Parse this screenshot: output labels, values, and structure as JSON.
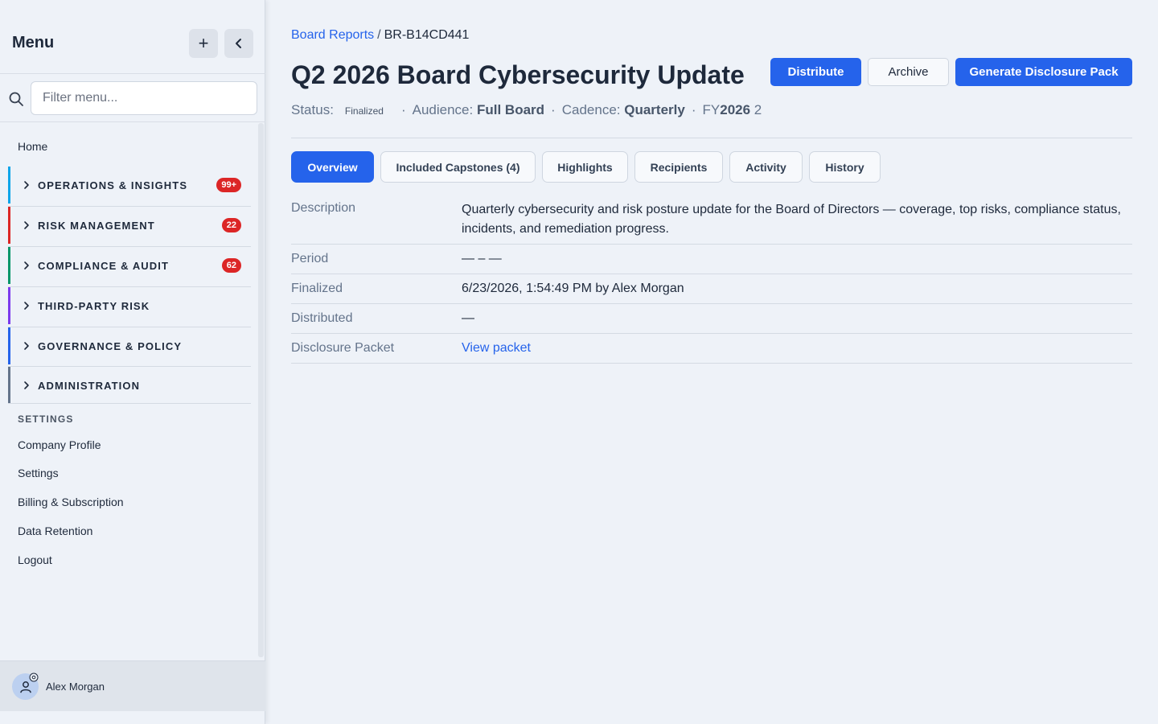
{
  "sidebar": {
    "title": "Menu",
    "add_symbol": "+",
    "filter_placeholder": "Filter menu...",
    "home": "Home",
    "groups": [
      {
        "label": "OPERATIONS & INSIGHTS",
        "badge": "99+",
        "color": "#0ea5e9"
      },
      {
        "label": "RISK MANAGEMENT",
        "badge": "22",
        "color": "#dc2626"
      },
      {
        "label": "COMPLIANCE & AUDIT",
        "badge": "62",
        "color": "#059669"
      },
      {
        "label": "THIRD-PARTY RISK",
        "badge": "",
        "color": "#7c3aed"
      },
      {
        "label": "GOVERNANCE & POLICY",
        "badge": "",
        "color": "#2563eb"
      },
      {
        "label": "ADMINISTRATION",
        "badge": "",
        "color": "#64748b"
      }
    ],
    "settings_label": "SETTINGS",
    "settings_items": [
      "Company Profile",
      "Settings",
      "Billing & Subscription",
      "Data Retention",
      "Logout"
    ],
    "user_name": "Alex Morgan"
  },
  "breadcrumb": {
    "parent": "Board Reports",
    "separator": "/",
    "current": "BR-B14CD441"
  },
  "header": {
    "title": "Q2 2026 Board Cybersecurity Update",
    "buttons": {
      "distribute": "Distribute",
      "archive": "Archive",
      "generate": "Generate Disclosure Pack"
    }
  },
  "meta": {
    "status_label": "Status:",
    "status_value": "Finalized",
    "audience_label": "Audience:",
    "audience_value": "Full Board",
    "cadence_label": "Cadence:",
    "cadence_value": "Quarterly",
    "fy_prefix": "FY",
    "fy_year": "2026",
    "fy_quarter": "2",
    "dot": "·"
  },
  "tabs": [
    {
      "label": "Overview",
      "active": true
    },
    {
      "label": "Included Capstones (4)",
      "active": false
    },
    {
      "label": "Highlights",
      "active": false
    },
    {
      "label": "Recipients",
      "active": false
    },
    {
      "label": "Activity",
      "active": false
    },
    {
      "label": "History",
      "active": false
    }
  ],
  "details": {
    "description_label": "Description",
    "description_value": "Quarterly cybersecurity and risk posture update for the Board of Directors — coverage, top risks, compliance status, incidents, and remediation progress.",
    "period_label": "Period",
    "period_value": "— – —",
    "finalized_label": "Finalized",
    "finalized_value": "6/23/2026, 1:54:49 PM by Alex Morgan",
    "distributed_label": "Distributed",
    "distributed_value": "—",
    "packet_label": "Disclosure Packet",
    "packet_link": "View packet"
  },
  "colors": {
    "accent": "#2563eb",
    "badge": "#dc2626"
  }
}
